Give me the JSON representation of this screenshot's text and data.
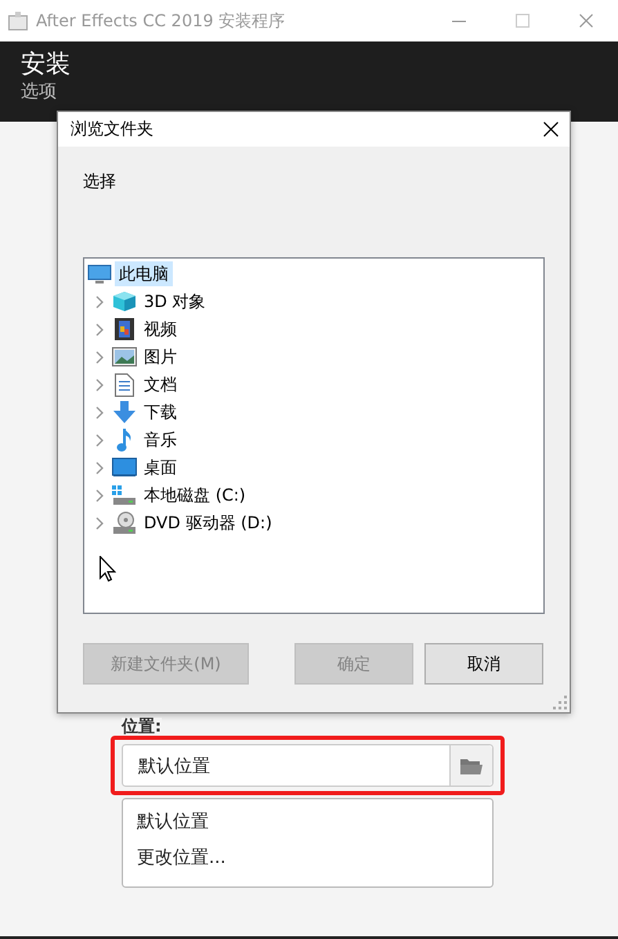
{
  "window": {
    "title": "After Effects CC 2019 安装程序"
  },
  "header": {
    "title": "安装",
    "subtitle": "选项"
  },
  "location": {
    "label": "位置:",
    "value": "默认位置",
    "options": [
      "默认位置",
      "更改位置..."
    ]
  },
  "dialog": {
    "title": "浏览文件夹",
    "prompt": "选择",
    "tree": [
      {
        "label": "此电脑",
        "kind": "computer",
        "selected": true,
        "children": [
          {
            "label": "3D 对象",
            "kind": "cube",
            "selected": false,
            "expanded": false
          },
          {
            "label": "视频",
            "kind": "film",
            "selected": false,
            "expanded": false
          },
          {
            "label": "图片",
            "kind": "image",
            "selected": false,
            "expanded": false
          },
          {
            "label": "文档",
            "kind": "document",
            "selected": false,
            "expanded": false
          },
          {
            "label": "下载",
            "kind": "download",
            "selected": false,
            "expanded": false
          },
          {
            "label": "音乐",
            "kind": "music",
            "selected": false,
            "expanded": false
          },
          {
            "label": "桌面",
            "kind": "desktop",
            "selected": false,
            "expanded": false
          },
          {
            "label": "本地磁盘 (C:)",
            "kind": "drive",
            "selected": false,
            "expanded": false
          },
          {
            "label": "DVD 驱动器 (D:)",
            "kind": "dvd",
            "selected": false,
            "expanded": false
          }
        ]
      }
    ],
    "buttons": [
      {
        "label": "新建文件夹(M)",
        "disabled": true
      },
      {
        "label": "确定",
        "disabled": true
      },
      {
        "label": "取消",
        "disabled": false
      }
    ]
  }
}
